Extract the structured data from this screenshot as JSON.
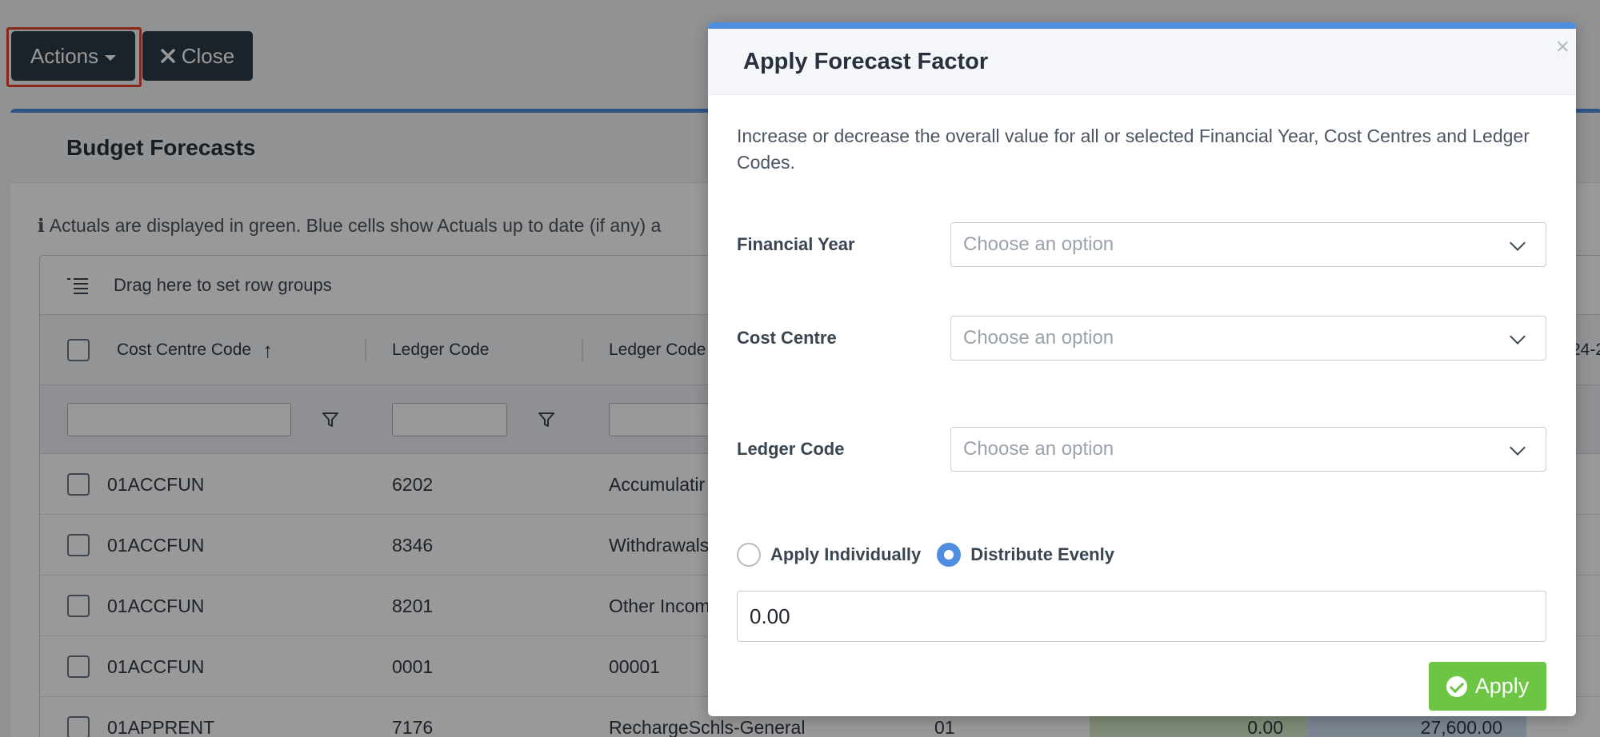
{
  "toolbar": {
    "actions_label": "Actions",
    "close_label": "Close"
  },
  "panel": {
    "title": "Budget Forecasts",
    "info_text": "Actuals are displayed in green. Blue cells show Actuals up to date (if any) a"
  },
  "grid": {
    "group_bar_text": "Drag here to set row groups",
    "columns": {
      "cost_centre_code": "Cost Centre Code",
      "ledger_code": "Ledger Code",
      "ledger_code_desc": "Ledger Code",
      "partial_right": "24-2"
    },
    "rows": [
      {
        "cost_centre": "01ACCFUN",
        "ledger": "6202",
        "desc": "Accumulatir",
        "extra": "",
        "green": "",
        "blue": ""
      },
      {
        "cost_centre": "01ACCFUN",
        "ledger": "8346",
        "desc": "Withdrawals",
        "extra": "",
        "green": "",
        "blue": ""
      },
      {
        "cost_centre": "01ACCFUN",
        "ledger": "8201",
        "desc": "Other Incom",
        "extra": "",
        "green": "",
        "blue": ""
      },
      {
        "cost_centre": "01ACCFUN",
        "ledger": "0001",
        "desc": "00001",
        "extra": "",
        "green": "",
        "blue": ""
      },
      {
        "cost_centre": "01APPRENT",
        "ledger": "7176",
        "desc": "RechargeSchls-General",
        "extra": "01",
        "green": "0.00",
        "blue": "27,600.00"
      }
    ]
  },
  "modal": {
    "title": "Apply Forecast Factor",
    "close_symbol": "×",
    "description": "Increase or decrease the overall value for all or selected Financial Year, Cost Centres and Ledger Codes.",
    "fields": {
      "financial_year_label": "Financial Year",
      "financial_year_value": "Choose an option",
      "cost_centre_label": "Cost Centre",
      "cost_centre_value": "Choose an option",
      "ledger_code_label": "Ledger Code",
      "ledger_code_value": "Choose an option"
    },
    "radio": {
      "apply_individually": "Apply Individually",
      "distribute_evenly": "Distribute Evenly",
      "selected": "distribute_evenly"
    },
    "value_input": "0.00",
    "apply_label": "Apply"
  },
  "colors": {
    "accent": "#4e8de0",
    "apply_green": "#6dc544",
    "dark_button": "#2c3947",
    "highlight_red": "#e5412f"
  }
}
